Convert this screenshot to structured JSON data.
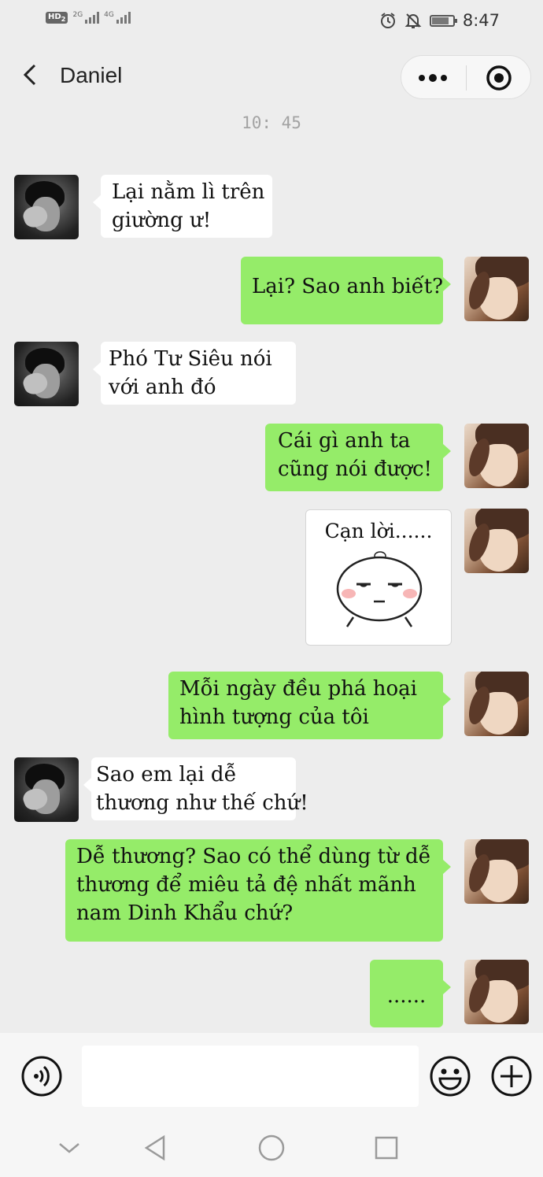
{
  "status_bar": {
    "hd": "HD",
    "hd_sub": "2",
    "signal1": "2G",
    "signal2": "4G",
    "time": "8:47",
    "battery_level": 0.75,
    "icons": [
      "alarm-icon",
      "mute-bell-icon",
      "battery-icon"
    ]
  },
  "header": {
    "title": "Daniel",
    "icons": [
      "back-chevron-icon",
      "more-dots-icon",
      "close-target-icon"
    ]
  },
  "chat": {
    "timestamp": "10: 45",
    "messages": [
      {
        "side": "left",
        "lines": [
          "Lại nằm lì trên",
          "giường ư!"
        ]
      },
      {
        "side": "right",
        "lines": [
          "Lại? Sao anh biết?"
        ]
      },
      {
        "side": "left",
        "lines": [
          "Phó Tư Siêu nói",
          "với anh đó"
        ]
      },
      {
        "side": "right",
        "lines": [
          "Cái gì anh ta",
          "cũng nói được!"
        ]
      },
      {
        "side": "right",
        "type": "sticker",
        "caption": "Cạn lời......"
      },
      {
        "side": "right",
        "lines": [
          "Mỗi ngày đều phá hoại",
          "hình tượng của tôi"
        ]
      },
      {
        "side": "left",
        "lines": [
          "Sao em lại dễ",
          "thương như thế chứ!"
        ]
      },
      {
        "side": "right",
        "lines": [
          "Dễ thương? Sao có thể dùng từ dễ",
          "thương để miêu tả đệ nhất mãnh",
          "nam Dinh Khẩu chứ?"
        ]
      },
      {
        "side": "right",
        "lines": [
          "......"
        ]
      }
    ]
  },
  "input_bar": {
    "placeholder": "",
    "icons": [
      "voice-icon",
      "emoji-icon",
      "plus-icon"
    ]
  },
  "nav_bar": {
    "icons": [
      "nav-collapse-icon",
      "nav-back-icon",
      "nav-home-icon",
      "nav-recents-icon"
    ]
  },
  "colors": {
    "background": "#ededed",
    "bubble_in": "#ffffff",
    "bubble_out": "#95ec69",
    "timestamp": "#a3a3a3"
  }
}
